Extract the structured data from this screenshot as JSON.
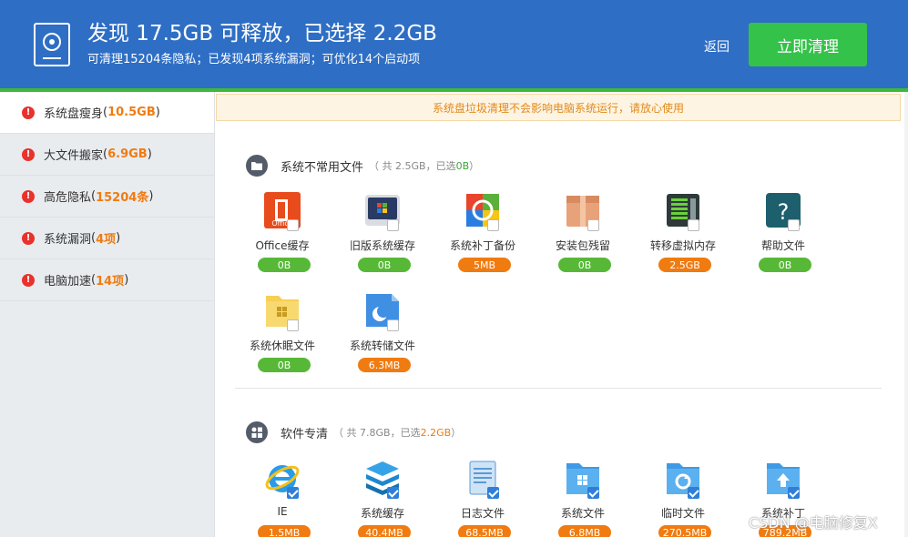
{
  "header": {
    "title": "发现 17.5GB 可释放，已选择 2.2GB",
    "subtitle": "可清理15204条隐私；已发现4项系统漏洞；可优化14个启动项",
    "back_label": "返回",
    "clean_label": "立即清理"
  },
  "sidebar": {
    "items": [
      {
        "label": "系统盘瘦身",
        "open": "(",
        "count": "10.5GB",
        "close": ")"
      },
      {
        "label": "大文件搬家",
        "open": "(",
        "count": "6.9GB",
        "close": ")"
      },
      {
        "label": "高危隐私",
        "open": "(",
        "count": "15204条",
        "close": ")"
      },
      {
        "label": "系统漏洞",
        "open": "(",
        "count": "4项",
        "close": ")"
      },
      {
        "label": "电脑加速",
        "open": "(",
        "count": "14项",
        "close": ")"
      }
    ]
  },
  "notice": "系统盘垃圾清理不会影响电脑系统运行，请放心使用",
  "sections": [
    {
      "title": "系统不常用文件",
      "meta": "（ 共 2.5GB，已选 ",
      "selected": "0B",
      "meta_end": " ）",
      "tiles": [
        {
          "label": "Office缓存",
          "size": "0B",
          "checked": false,
          "icon": "office-icon"
        },
        {
          "label": "旧版系统缓存",
          "size": "0B",
          "checked": false,
          "icon": "old-windows-icon"
        },
        {
          "label": "系统补丁备份",
          "size": "5MB",
          "checked": false,
          "icon": "patch-backup-icon"
        },
        {
          "label": "安装包残留",
          "size": "0B",
          "checked": false,
          "icon": "package-icon"
        },
        {
          "label": "转移虚拟内存",
          "size": "2.5GB",
          "checked": false,
          "icon": "memory-icon"
        },
        {
          "label": "帮助文件",
          "size": "0B",
          "checked": false,
          "icon": "help-icon"
        },
        {
          "label": "系统休眠文件",
          "size": "0B",
          "checked": false,
          "icon": "hibernate-folder-icon"
        },
        {
          "label": "系统转储文件",
          "size": "6.3MB",
          "checked": false,
          "icon": "dump-file-icon"
        }
      ]
    },
    {
      "title": "软件专清",
      "meta": "（ 共 7.8GB，已选 ",
      "selected": "2.2GB",
      "meta_end": " ）",
      "tiles": [
        {
          "label": "IE",
          "size": "1.5MB",
          "checked": true,
          "icon": "ie-icon"
        },
        {
          "label": "系统缓存",
          "size": "40.4MB",
          "checked": true,
          "icon": "cache-stack-icon"
        },
        {
          "label": "日志文件",
          "size": "68.5MB",
          "checked": true,
          "icon": "log-file-icon"
        },
        {
          "label": "系统文件",
          "size": "6.8MB",
          "checked": true,
          "icon": "system-folder-icon"
        },
        {
          "label": "临时文件",
          "size": "270.5MB",
          "checked": true,
          "icon": "temp-folder-icon"
        },
        {
          "label": "系统补丁",
          "size": "789.2MB",
          "checked": true,
          "icon": "patch-folder-icon"
        }
      ]
    }
  ],
  "watermark": "CSDN @电脑修复X",
  "colors": {
    "header": "#2e6ec4",
    "accent_green": "#35c24a",
    "badge_orange": "#f07b10",
    "badge_green": "#57b837",
    "alert_red": "#e8322d"
  }
}
